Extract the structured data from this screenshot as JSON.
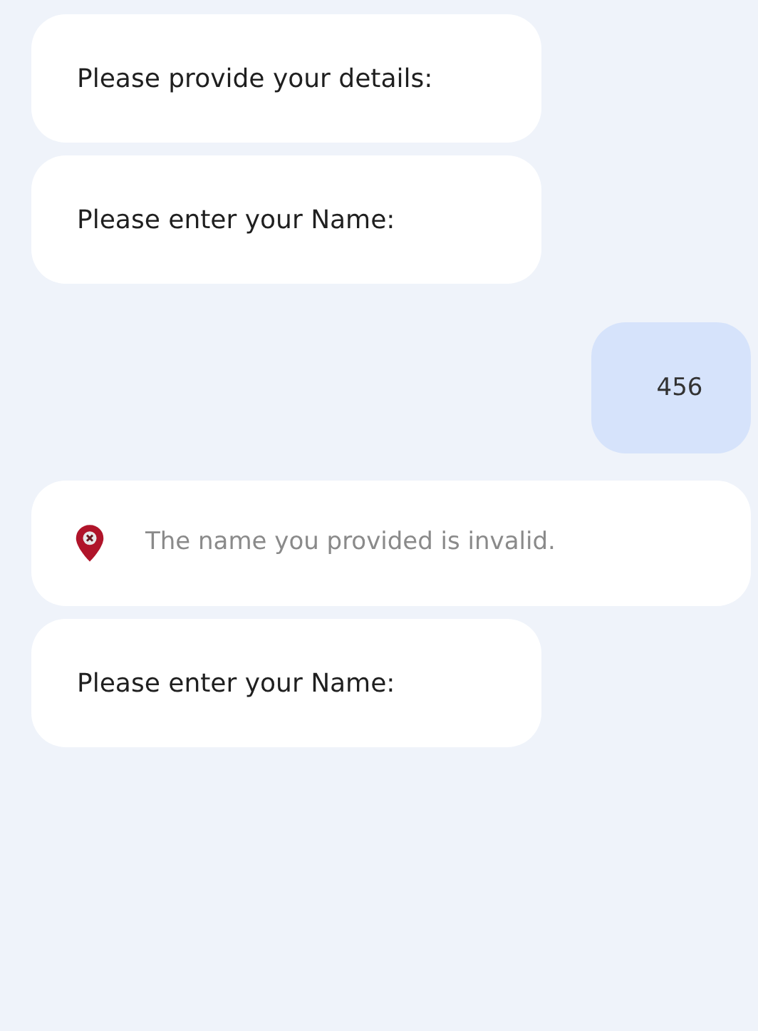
{
  "messages": [
    {
      "kind": "bot",
      "text": "Please provide your details:"
    },
    {
      "kind": "bot",
      "text": "Please enter your Name:"
    },
    {
      "kind": "user",
      "text": "456"
    },
    {
      "kind": "error",
      "text": "The name you provided is invalid."
    },
    {
      "kind": "bot",
      "text": "Please enter your Name:"
    }
  ]
}
